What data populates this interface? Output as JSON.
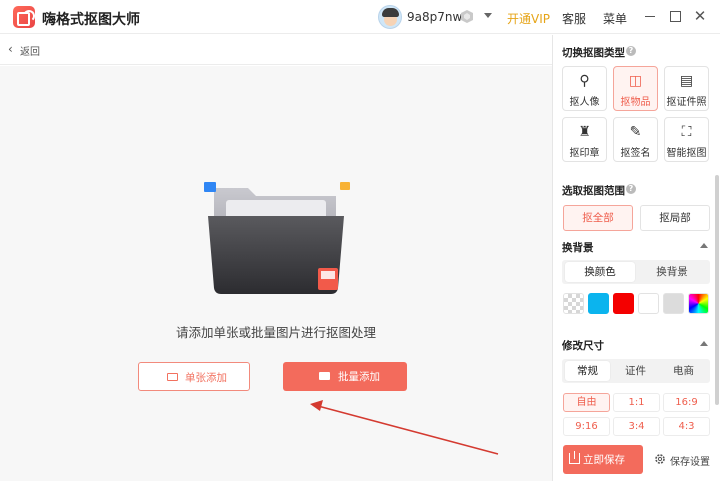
{
  "app": {
    "title": "嗨格式抠图大师"
  },
  "header": {
    "username": "9a8p7nw",
    "vip_label": "开通VIP",
    "service_label": "客服",
    "menu_label": "菜单",
    "accent_color": "#e6a417"
  },
  "backbar": {
    "back_label": "返回"
  },
  "main": {
    "hint": "请添加单张或批量图片进行抠图处理",
    "single_add_label": "单张添加",
    "batch_add_label": "批量添加"
  },
  "panel": {
    "type_title": "切换抠图类型",
    "types": [
      {
        "label": "抠人像",
        "icon": "person-icon"
      },
      {
        "label": "抠物品",
        "icon": "box-icon"
      },
      {
        "label": "抠证件照",
        "icon": "id-card-icon"
      },
      {
        "label": "抠印章",
        "icon": "stamp-icon"
      },
      {
        "label": "抠签名",
        "icon": "pen-icon"
      },
      {
        "label": "智能抠图",
        "icon": "smart-cut-icon"
      }
    ],
    "selected_type": "抠物品",
    "range_title": "选取抠图范围",
    "range_options": [
      "抠全部",
      "抠局部"
    ],
    "selected_range": "抠全部",
    "bg_title": "换背景",
    "bg_tabs": [
      "换颜色",
      "换背景"
    ],
    "selected_bg_tab": "换颜色",
    "swatches": [
      {
        "name": "transparent",
        "color": "checker"
      },
      {
        "name": "blue",
        "color": "#0bb4ee"
      },
      {
        "name": "red",
        "color": "#f40000"
      },
      {
        "name": "white",
        "color": "#ffffff"
      },
      {
        "name": "gray",
        "color": "#dcdcdc"
      },
      {
        "name": "rainbow",
        "color": "gradient"
      }
    ],
    "size_title": "修改尺寸",
    "size_tabs": [
      "常规",
      "证件",
      "电商"
    ],
    "selected_size_tab": "常规",
    "ratios": [
      "自由",
      "1:1",
      "16:9",
      "9:16",
      "3:4",
      "4:3"
    ],
    "selected_ratio": "自由",
    "save_label": "立即保存",
    "save_settings_label": "保存设置",
    "brand_color": "#f36b5c"
  }
}
